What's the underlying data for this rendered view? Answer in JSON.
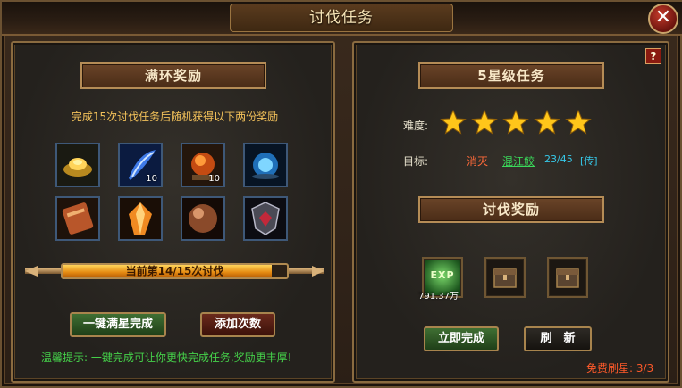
{
  "window": {
    "title": "讨伐任务",
    "close_symbol": "✕"
  },
  "left": {
    "header": "满环奖励",
    "description": "完成15次讨伐任务后随机获得以下两份奖励",
    "rewards": [
      {
        "icon": "gold-ingot-icon",
        "count": ""
      },
      {
        "icon": "blue-feather-icon",
        "count": "10"
      },
      {
        "icon": "fire-orb-icon",
        "count": "10"
      },
      {
        "icon": "blue-orb-icon",
        "count": ""
      },
      {
        "icon": "scroll-icon",
        "count": ""
      },
      {
        "icon": "crystal-icon",
        "count": ""
      },
      {
        "icon": "bronze-orb-icon",
        "count": ""
      },
      {
        "icon": "shield-emblem-icon",
        "count": ""
      }
    ],
    "progress": {
      "label": "当前第14/15次讨伐",
      "current": 14,
      "total": 15
    },
    "buttons": {
      "complete_all": "一键满星完成",
      "add_times": "添加次数"
    },
    "tip": "温馨提示: 一键完成可让你更快完成任务,奖励更丰厚!"
  },
  "right": {
    "help_symbol": "?",
    "header": "5星级任务",
    "difficulty_label": "难度:",
    "stars": 5,
    "target_label": "目标:",
    "target_verb": "消灭",
    "target_monster": "混江鲛",
    "target_progress": "23/45",
    "target_teleport": "[传]",
    "reward_header": "讨伐奖励",
    "exp_icon_text": "EXP",
    "exp_amount": "791.37万",
    "buttons": {
      "complete_now": "立即完成",
      "refresh": "刷　新"
    },
    "free_refresh": "免费刷星: 3/3"
  },
  "colors": {
    "gold_text": "#f2c15a",
    "green_tip": "#45d14a",
    "star_fill": "#ffc61a",
    "target_red": "#ff6a3a",
    "target_green": "#3ad95a",
    "target_cyan": "#36c8e8",
    "refresh_red": "#ff5a2a"
  }
}
